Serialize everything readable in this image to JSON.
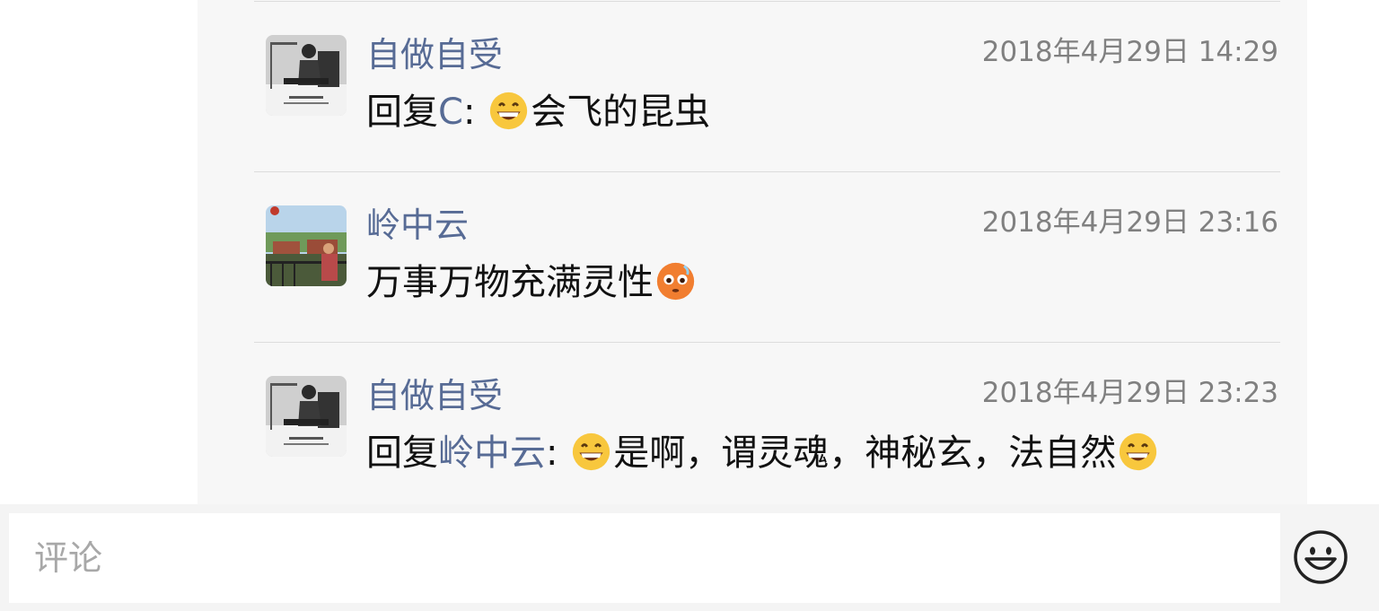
{
  "comments": [
    {
      "author": "自做自受",
      "time": "2018年4月29日 14:29",
      "reply_prefix": "回复",
      "reply_to": "C",
      "colon": ":",
      "emoji_lead": "grinning-face-emoji",
      "text": "会飞的昆虫",
      "emoji_trail": ""
    },
    {
      "author": "岭中云",
      "time": "2018年4月29日 23:16",
      "text": "万事万物充满灵性",
      "emoji_trail": "flushed-face-emoji"
    },
    {
      "author": "自做自受",
      "time": "2018年4月29日 23:23",
      "reply_prefix": "回复",
      "reply_to": "岭中云",
      "colon": ":",
      "emoji_lead": "grinning-face-emoji",
      "text": "是啊，谓灵魂，神秘玄，法自然",
      "emoji_trail": "grinning-face-emoji"
    }
  ],
  "input": {
    "placeholder": "评论",
    "value": ""
  },
  "icons": {
    "emoji_button": "smiley-face-icon"
  },
  "colors": {
    "link": "#576b95",
    "timestamp": "#808080",
    "panel_background": "#f7f7f7"
  }
}
